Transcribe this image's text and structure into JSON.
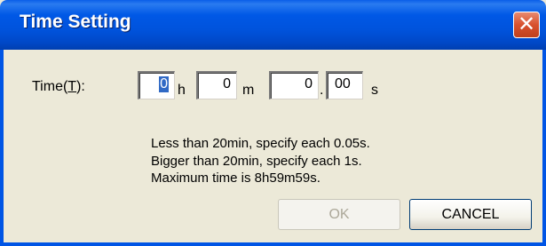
{
  "window": {
    "title": "Time Setting"
  },
  "form": {
    "time_label_prefix": "Time(",
    "time_label_accel": "T",
    "time_label_suffix": "):",
    "hours": "0",
    "hours_unit": "h",
    "minutes": "0",
    "minutes_unit": "m",
    "seconds": "0",
    "separator": ".",
    "centiseconds": "00",
    "seconds_unit": "s"
  },
  "info": {
    "line1": "Less than 20min, specify each 0.05s.",
    "line2": "Bigger than 20min, specify each 1s.",
    "line3": "Maximum time is 8h59m59s."
  },
  "buttons": {
    "ok": "OK",
    "cancel": "CANCEL"
  },
  "icons": {
    "close": "close-icon"
  }
}
